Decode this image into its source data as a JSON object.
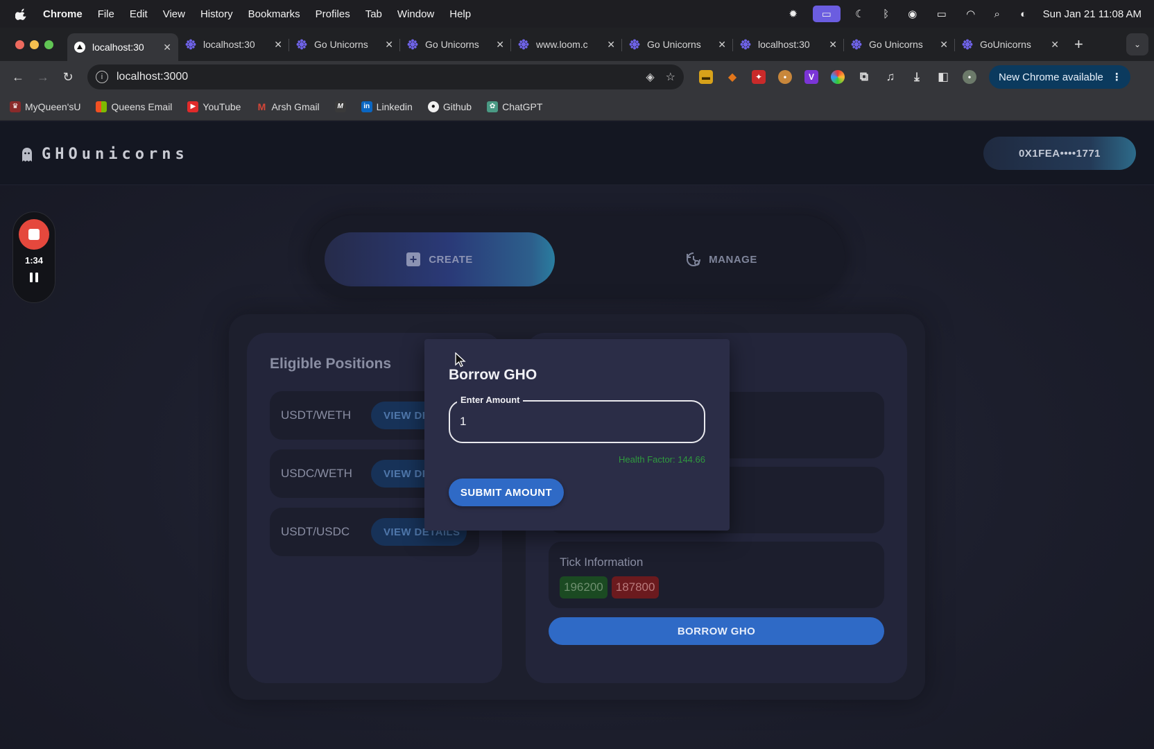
{
  "menubar": {
    "app": "Chrome",
    "items": [
      "File",
      "Edit",
      "View",
      "History",
      "Bookmarks",
      "Profiles",
      "Tab",
      "Window",
      "Help"
    ],
    "clock": "Sun Jan 21  11:08 AM"
  },
  "tabs": [
    {
      "title": "localhost:30",
      "favicon": "vercel-triangle-icon",
      "active": true
    },
    {
      "title": "localhost:30",
      "favicon": "unicorn-flower-icon"
    },
    {
      "title": "Go Unicorns",
      "favicon": "unicorn-flower-icon"
    },
    {
      "title": "Go Unicorns",
      "favicon": "unicorn-flower-icon"
    },
    {
      "title": "www.loom.c",
      "favicon": "unicorn-flower-icon"
    },
    {
      "title": "Go Unicorns",
      "favicon": "unicorn-flower-icon"
    },
    {
      "title": "localhost:30",
      "favicon": "unicorn-flower-icon"
    },
    {
      "title": "Go Unicorns",
      "favicon": "unicorn-flower-icon"
    },
    {
      "title": "GoUnicorns",
      "favicon": "unicorn-flower-icon"
    }
  ],
  "toolbar": {
    "url": "localhost:3000",
    "new_chrome": "New Chrome available"
  },
  "bookmarks": [
    {
      "label": "MyQueen'sU",
      "color": "#8a2a2a"
    },
    {
      "label": "Queens Email",
      "color": "#e0622a"
    },
    {
      "label": "YouTube",
      "color": "#e02a2a"
    },
    {
      "label": "Arsh Gmail",
      "color": "#d44638"
    },
    {
      "label": "",
      "color": "#3a3a3a"
    },
    {
      "label": "Linkedin",
      "color": "#0a66c2"
    },
    {
      "label": "Github",
      "color": "#111111"
    },
    {
      "label": "ChatGPT",
      "color": "#4a9a84"
    }
  ],
  "app": {
    "brand": "GHOunicorns",
    "wallet": "0X1FEA••••1771",
    "modes": {
      "create": "CREATE",
      "manage": "MANAGE"
    },
    "positions_title": "Eligible Positions",
    "positions": [
      {
        "pair": "USDT/WETH",
        "button": "VIEW DE"
      },
      {
        "pair": "USDC/WETH",
        "button": "VIEW DE"
      },
      {
        "pair": "USDT/USDC",
        "button": "VIEW DETAILS"
      }
    ],
    "tick_title": "Tick Information",
    "ticks": [
      "196200",
      "187800"
    ],
    "borrow_button": "BORROW GHO"
  },
  "loom": {
    "time": "1:34"
  },
  "dialog": {
    "title": "Borrow GHO",
    "field_label": "Enter Amount",
    "amount": "1",
    "health_factor": "Health Factor: 144.66",
    "submit": "SUBMIT AMOUNT"
  }
}
